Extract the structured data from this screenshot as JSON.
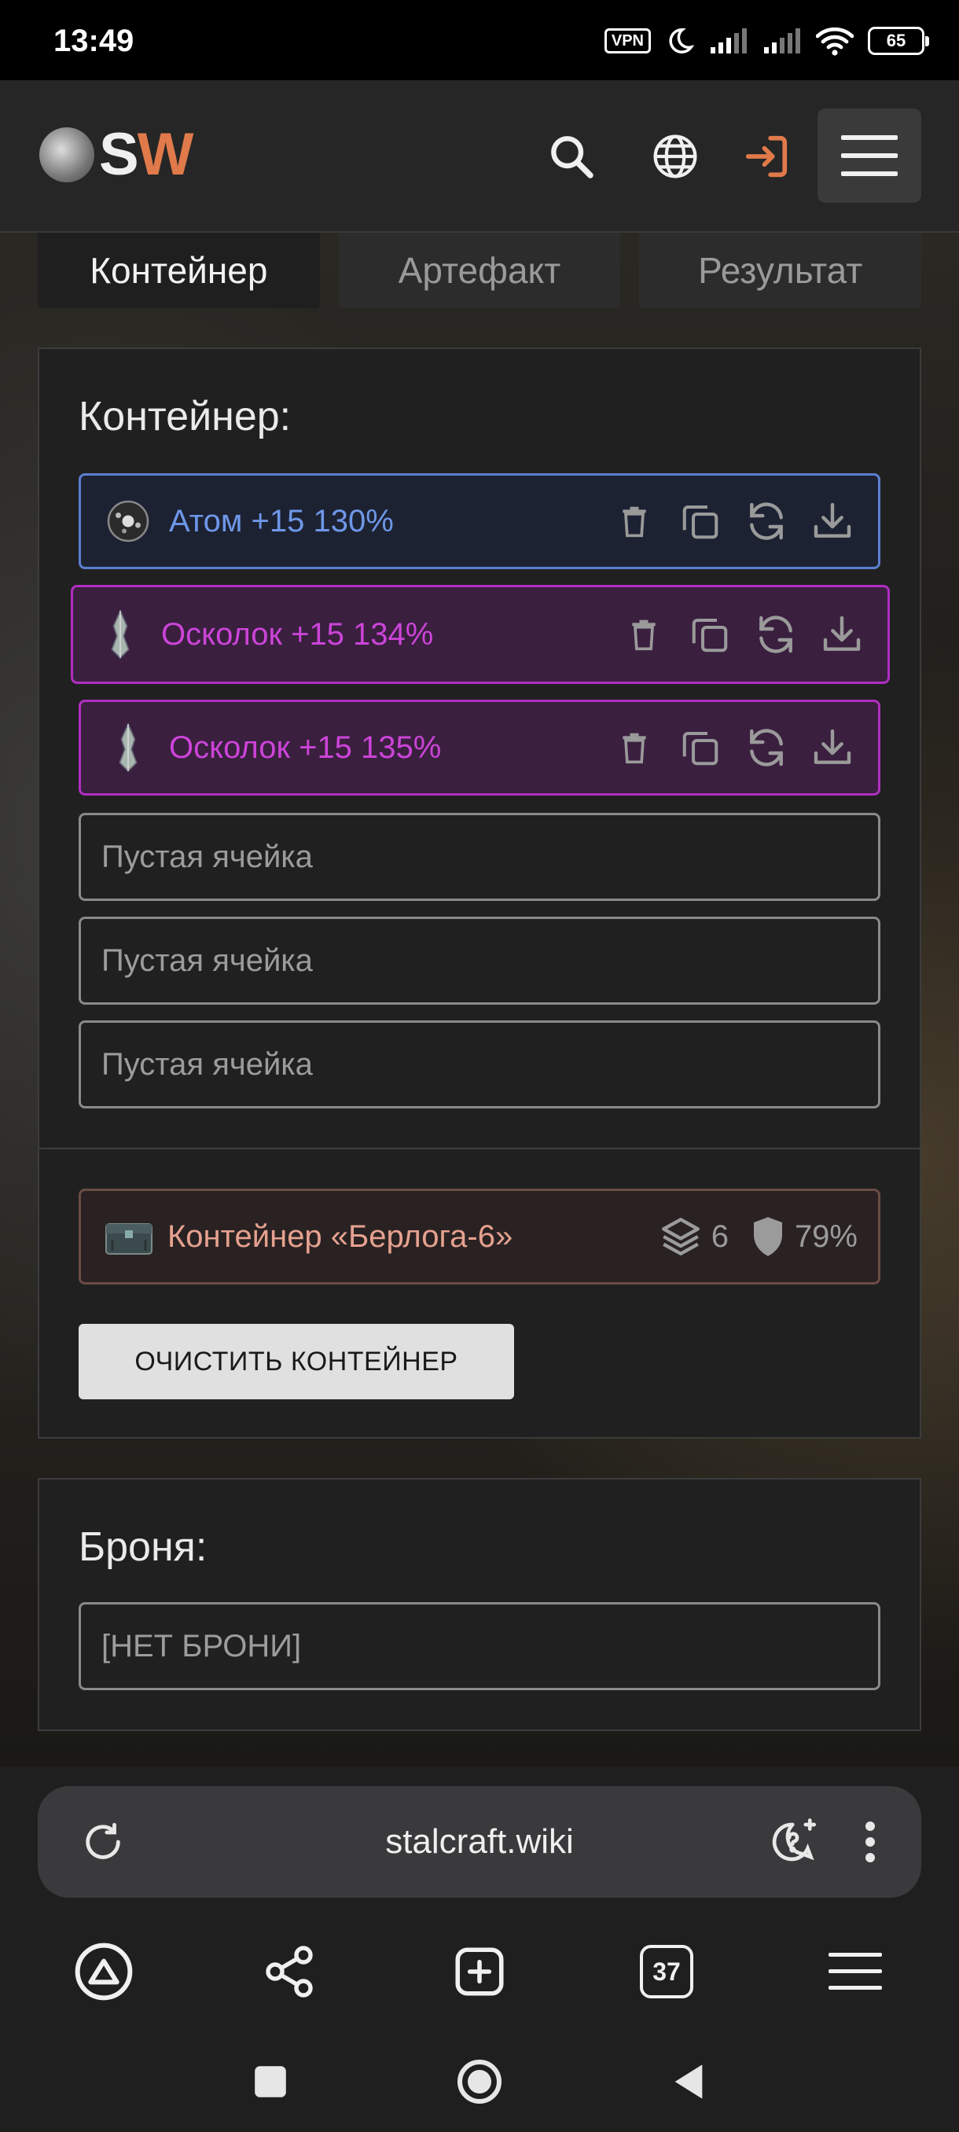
{
  "status_bar": {
    "time": "13:49",
    "vpn": "VPN",
    "battery": "65"
  },
  "header": {
    "logo_s": "S",
    "logo_w": "W",
    "icons": [
      "search-icon",
      "globe-icon",
      "login-icon",
      "menu-icon"
    ],
    "accent": "#e07a4a"
  },
  "tabs": [
    {
      "label": "Контейнер",
      "active": true
    },
    {
      "label": "Артефакт",
      "active": false
    },
    {
      "label": "Результат",
      "active": false
    }
  ],
  "container_panel": {
    "title": "Контейнер:",
    "slots": [
      {
        "name": "Атом +15 130%",
        "rarity_color": "#6e97e8"
      },
      {
        "name": "Осколок +15 134%",
        "rarity_color": "#cc44d8"
      },
      {
        "name": "Осколок +15 135%",
        "rarity_color": "#cc44d8"
      }
    ],
    "empty_slots": [
      "Пустая ячейка",
      "Пустая ячейка",
      "Пустая ячейка"
    ],
    "container": {
      "name": "Контейнер «Берлога-6»",
      "capacity": "6",
      "protection": "79%"
    },
    "clear_button": "ОЧИСТИТЬ КОНТЕЙНЕР"
  },
  "armor_panel": {
    "title": "Броня:",
    "value": "[НЕТ БРОНИ]"
  },
  "browser": {
    "url": "stalcraft.wiki",
    "tab_count": "37"
  }
}
